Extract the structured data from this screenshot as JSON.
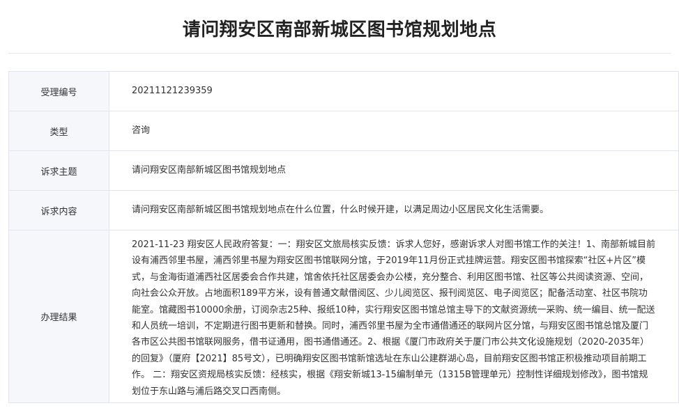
{
  "page": {
    "title": "请问翔安区南部新城区图书馆规划地点"
  },
  "rows": [
    {
      "label": "受理编号",
      "value": "20211121239359"
    },
    {
      "label": "类型",
      "value": "咨询"
    },
    {
      "label": "诉求主题",
      "value": "请问翔安区南部新城区图书馆规划地点"
    },
    {
      "label": "诉求内容",
      "value": "请问翔安区南部新城区图书馆规划地点在什么位置，什么时候开建，以满足周边小区居民文化生活需要。"
    },
    {
      "label": "办理结果",
      "value": "2021-11-23 翔安区人民政府答复：一：翔安区文旅局核实反馈：诉求人您好，感谢诉求人对图书馆工作的关注！1、南部新城目前设有浦西邻里书屋，浦西邻里书屋为翔安区图书馆联网分馆，于2019年11月份正式挂牌运营。翔安区图书馆探索“社区+片区”模式，与金海街道浦西社区居委会合作共建，馆舍依托社区居委会办公楼，充分整合、利用区图书馆、社区等公共阅读资源、空间，向社会公众开放。占地面积189平方米，设有普通文献借阅区、少儿阅览区、报刊阅览区、电子阅览区；配备活动室、社区书院功能室。馆藏图书10000余册，订阅杂志25种、报纸10种，实行翔安区图书馆总馆主导下的文献资源统一采购、统一编目、统一配送和人员统一培训，不定期进行图书更新和替换。同时，浦西邻里书屋为全市通借通还的联网片区分馆，与翔安区图书馆总馆及厦门各市区公共图书馆联网服务，借书证通用，图书通借通还。2、根据《厦门市政府关于厦门市公共文化设施规划（2020-2035年）的回复》（厦府【2021】85号文），已明确翔安区图书馆新馆选址在东山公建群湖心岛，目前翔安区图书馆正积极推动项目前期工作。 二：翔安区资规局核实反馈：经核实，根据《翔安新城13-15编制单元（1315B管理单元）控制性详细规划修改》，图书馆规划位于东山路与浦后路交叉口西南侧。"
    }
  ]
}
